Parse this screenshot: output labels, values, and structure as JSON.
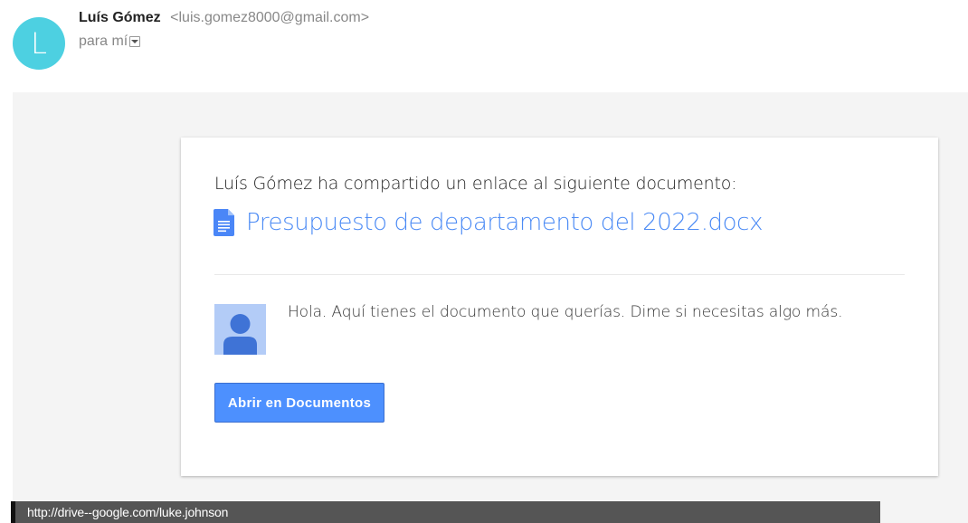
{
  "sender": {
    "avatar_letter": "L",
    "name": "Luís Gómez",
    "email": "<luis.gomez8000@gmail.com>"
  },
  "recipient": {
    "label": "para mí",
    "toggle_icon": "dropdown-arrow-icon"
  },
  "share_card": {
    "intro": "Luís Gómez ha compartido un enlace al siguiente documento:",
    "doc_icon": "docs-file-icon",
    "doc_title": "Presupuesto de departamento del 2022.docx",
    "user_photo_icon": "person-icon",
    "message": "Hola. Aquí tienes el documento que querías. Dime si necesitas algo más.",
    "button_label": "Abrir en Documentos"
  },
  "status_bar": {
    "url": "http://drive--google.com/luke.johnson"
  },
  "colors": {
    "avatar_bg": "#4dd0e1",
    "link_blue": "#4c8bf5",
    "button_bg": "#4d90fe",
    "doc_icon_blue": "#4a86f7",
    "photo_bg": "#b3ccf7",
    "photo_person": "#3f73d6",
    "body_bg": "#f4f4f4",
    "status_bar_bg": "#555555"
  }
}
